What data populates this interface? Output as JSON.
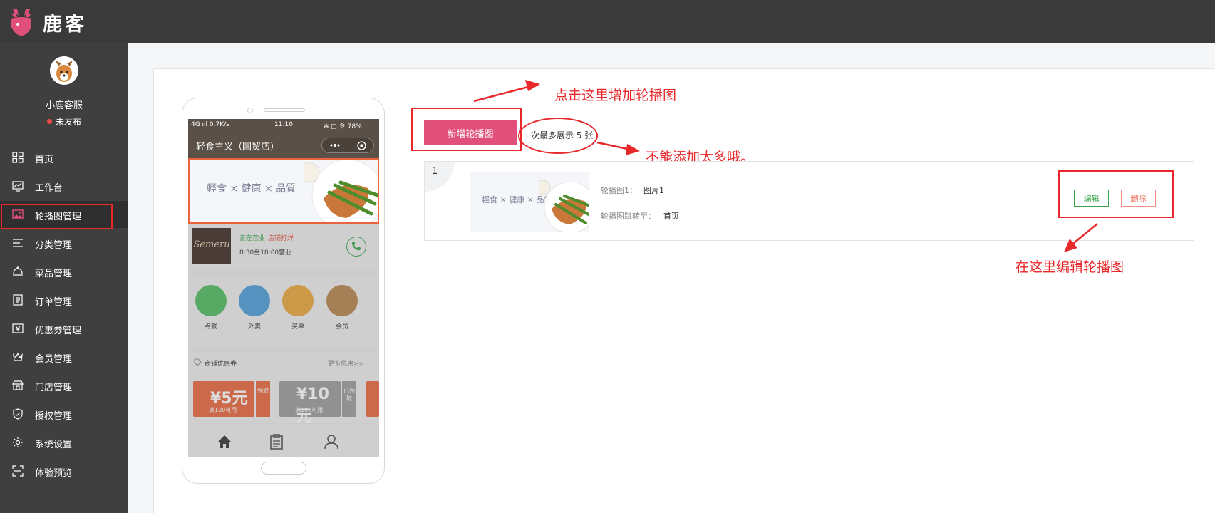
{
  "app": {
    "brand": "鹿客",
    "brand_color": "#e1507a"
  },
  "profile": {
    "name": "小鹿客服",
    "status": "未发布",
    "status_color": "#e84a4a"
  },
  "sidebar": {
    "items": [
      {
        "label": "首页",
        "icon": "grid-icon"
      },
      {
        "label": "工作台",
        "icon": "chart-monitor-icon"
      },
      {
        "label": "轮播图管理",
        "icon": "image-icon",
        "active": true
      },
      {
        "label": "分类管理",
        "icon": "list-icon"
      },
      {
        "label": "菜品管理",
        "icon": "cloche-icon"
      },
      {
        "label": "订单管理",
        "icon": "document-icon"
      },
      {
        "label": "优惠券管理",
        "icon": "yen-ticket-icon"
      },
      {
        "label": "会员管理",
        "icon": "crown-icon"
      },
      {
        "label": "门店管理",
        "icon": "store-icon"
      },
      {
        "label": "授权管理",
        "icon": "shield-check-icon"
      },
      {
        "label": "系统设置",
        "icon": "gear-icon"
      },
      {
        "label": "体验预览",
        "icon": "scan-icon"
      }
    ]
  },
  "phone": {
    "statusbar": {
      "left": "4G ııl 0.7K/s",
      "time": "11:10",
      "right": "✻ ◫ 令 78%"
    },
    "title": "轻食主义（国贸店）",
    "banner_text": "輕食 × 健康 × 品質",
    "store": {
      "logo": "Semeru",
      "open": "正在营业",
      "tag": "店铺打烊",
      "hours": "8:30至18:00营业"
    },
    "icons": [
      {
        "label": "点餐",
        "color": "#4cba5c"
      },
      {
        "label": "外卖",
        "color": "#4a9bd9"
      },
      {
        "label": "买单",
        "color": "#e8a53a"
      },
      {
        "label": "会员",
        "color": "#b5824a"
      }
    ],
    "coupons_title": "商铺优惠券",
    "coupons_more": "更多优惠>>",
    "coupons": [
      {
        "value": "¥5元",
        "cond": "满100可用",
        "side": "领取",
        "color": "#e8643c"
      },
      {
        "value": "¥10元",
        "cond": "满100可用",
        "side": "已领取",
        "color": "#9a9a9a"
      }
    ]
  },
  "controls": {
    "add_button": "新增轮播图",
    "hint": "一次最多展示 5 张"
  },
  "annotations": {
    "add": "点击这里增加轮播图",
    "limit": "不能添加太多哦。",
    "edit": "在这里编辑轮播图",
    "color": "#e8282b"
  },
  "carousel_list": [
    {
      "index": "1",
      "thumb_text": "輕食 × 健康 × 品質",
      "image_label": "轮播图1：",
      "image_value": "图片1",
      "link_label": "轮播图跳转至：",
      "link_value": "首页",
      "edit": "编辑",
      "delete": "删除"
    }
  ]
}
